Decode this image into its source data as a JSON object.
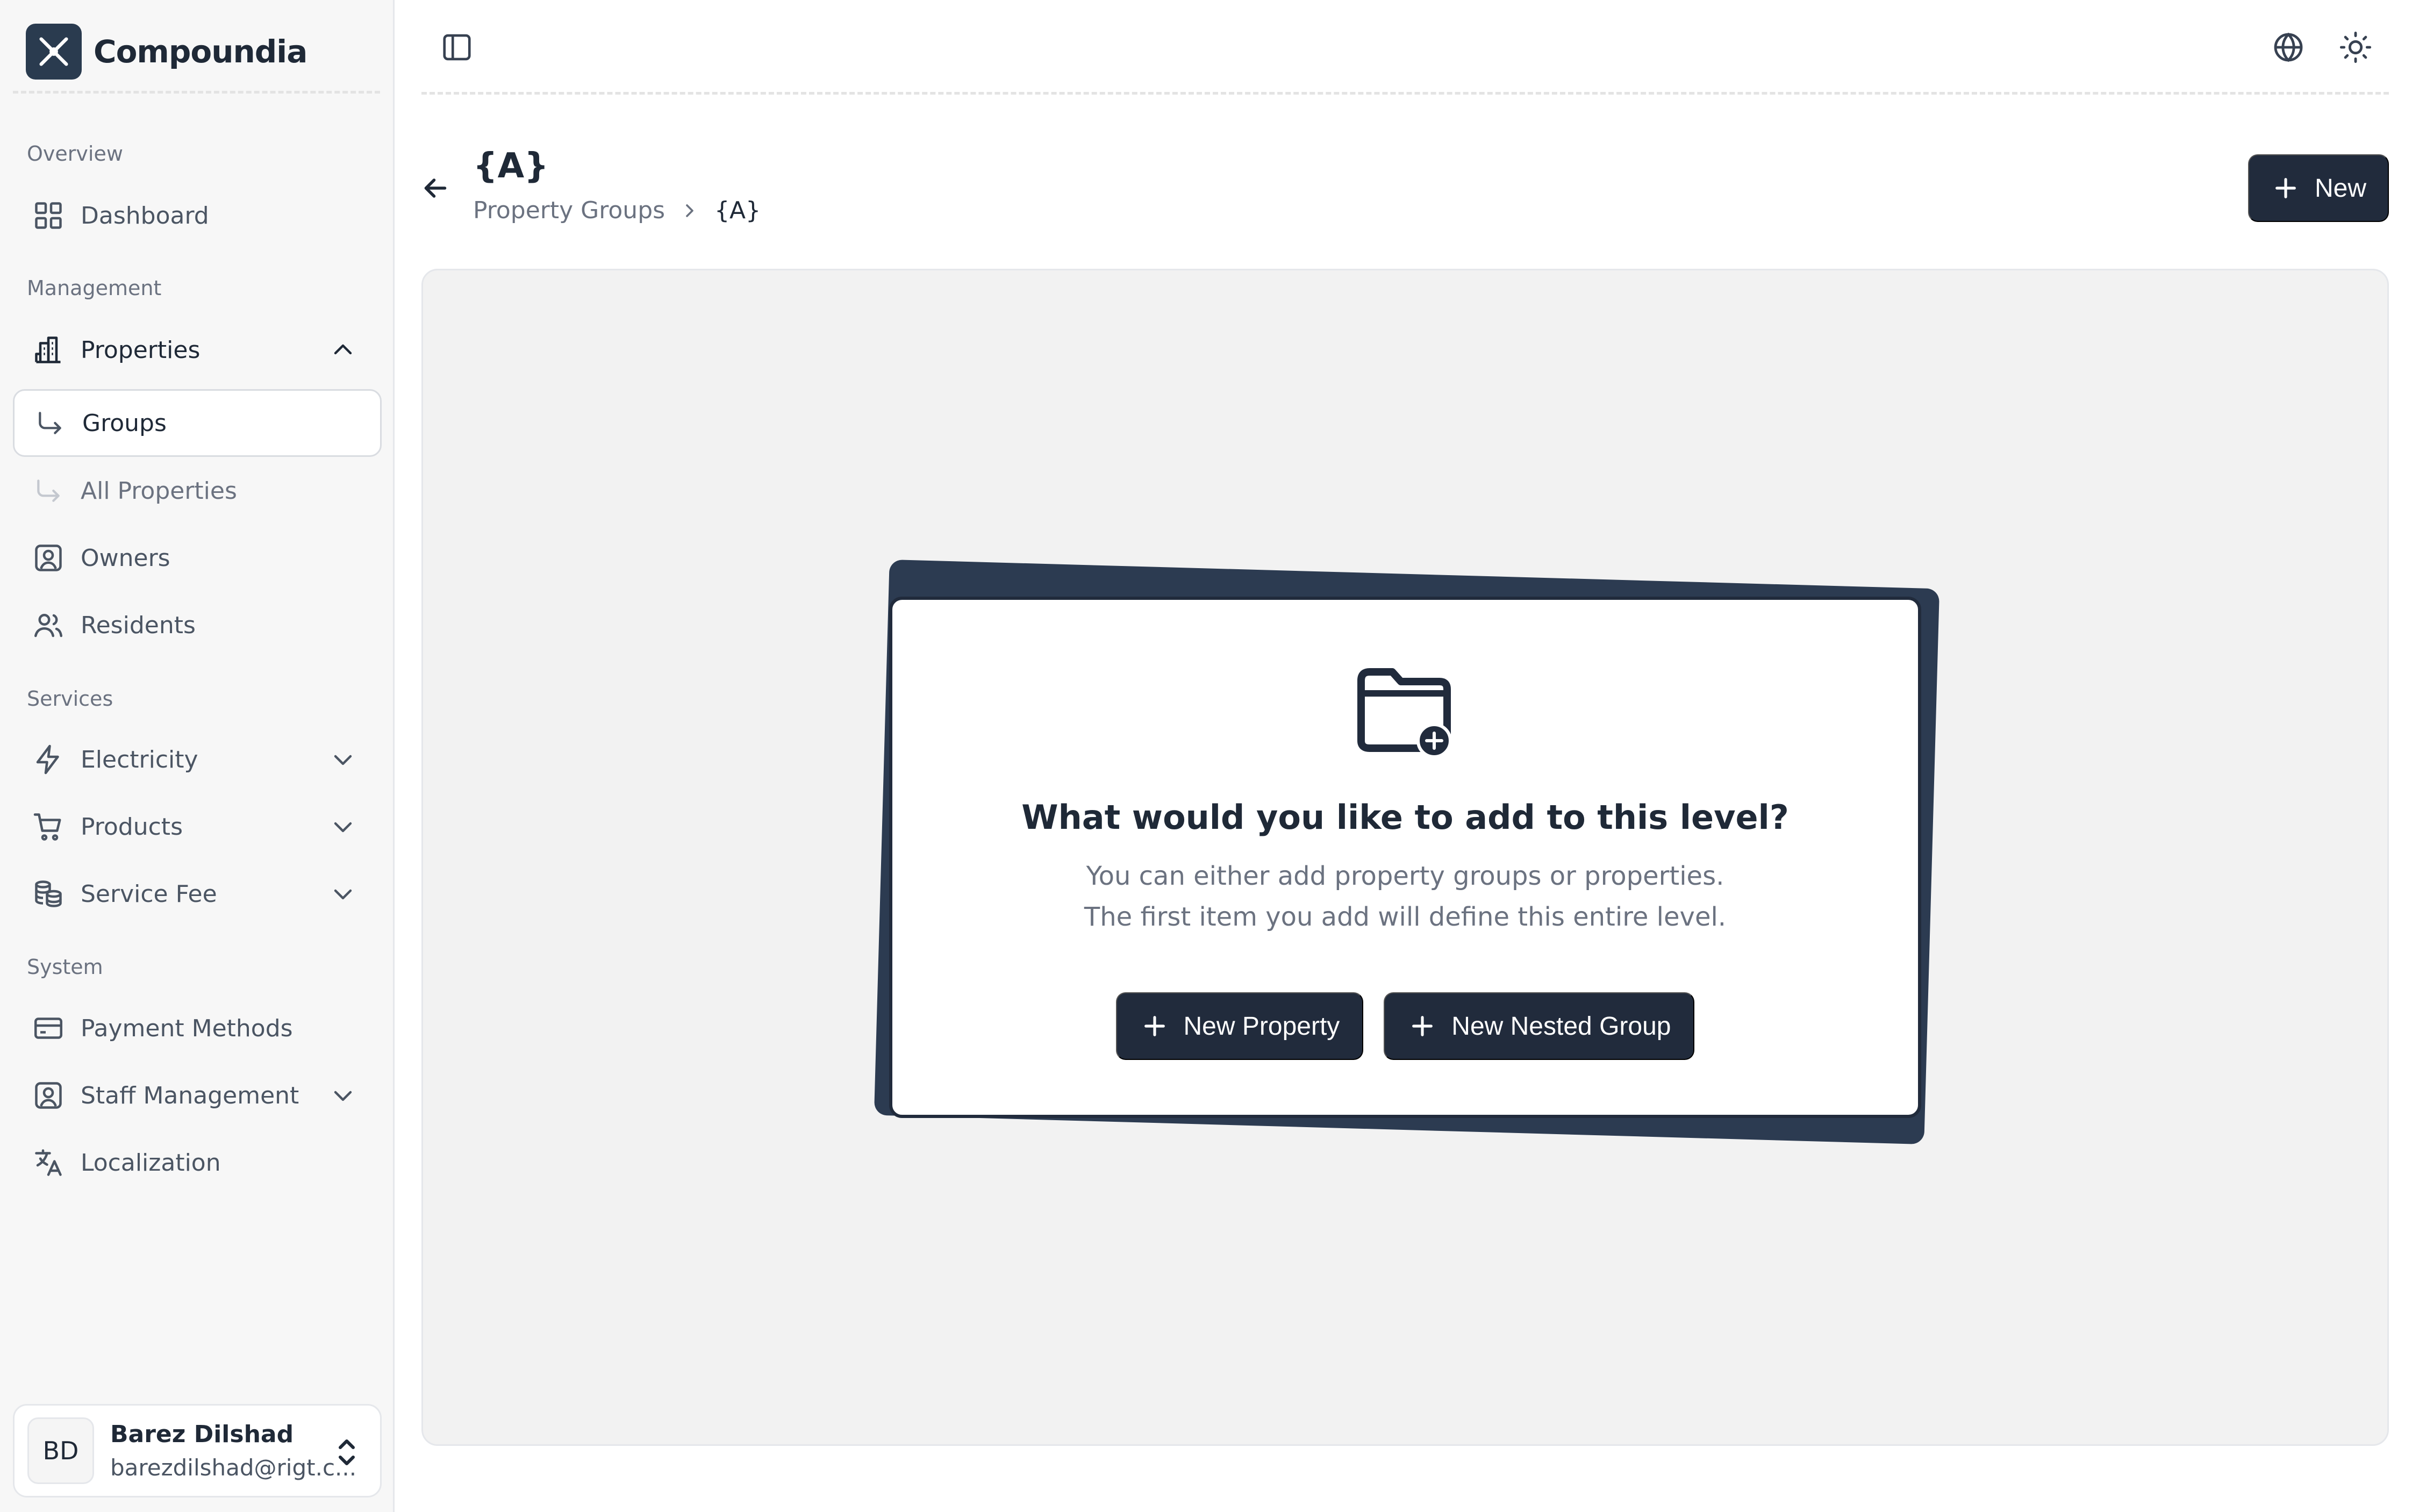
{
  "brand": {
    "name": "Compoundia"
  },
  "sidebar": {
    "sections": {
      "overview": "Overview",
      "management": "Management",
      "services": "Services",
      "system": "System"
    },
    "items": {
      "dashboard": "Dashboard",
      "properties": "Properties",
      "groups": "Groups",
      "all_properties": "All Properties",
      "owners": "Owners",
      "residents": "Residents",
      "electricity": "Electricity",
      "products": "Products",
      "service_fee": "Service Fee",
      "payment_methods": "Payment Methods",
      "staff_management": "Staff Management",
      "localization": "Localization"
    },
    "active_item": "groups",
    "user": {
      "initials": "BD",
      "name": "Barez Dilshad",
      "email": "barezdilshad@rigt.c..."
    }
  },
  "header": {
    "title": "{A}",
    "breadcrumb": [
      "Property Groups",
      "{A}"
    ],
    "new_label": "New"
  },
  "empty_state": {
    "heading": "What would you like to add to this level?",
    "line1": "You can either add property groups or properties.",
    "line2": "The first item you add will define this entire level.",
    "new_property_label": "New Property",
    "new_nested_group_label": "New Nested Group"
  },
  "colors": {
    "primary": "#212b3c",
    "sidebar_bg": "#f7f7f7",
    "panel_bg": "#f2f2f2",
    "muted_text": "#6b7280"
  },
  "icons": {
    "logo": "compoundia-logo-icon",
    "sidebar_toggle": "sidebar-toggle-icon",
    "language": "globe-icon",
    "theme": "sun-icon",
    "back": "arrow-left-icon",
    "empty_state": "folder-plus-icon"
  }
}
